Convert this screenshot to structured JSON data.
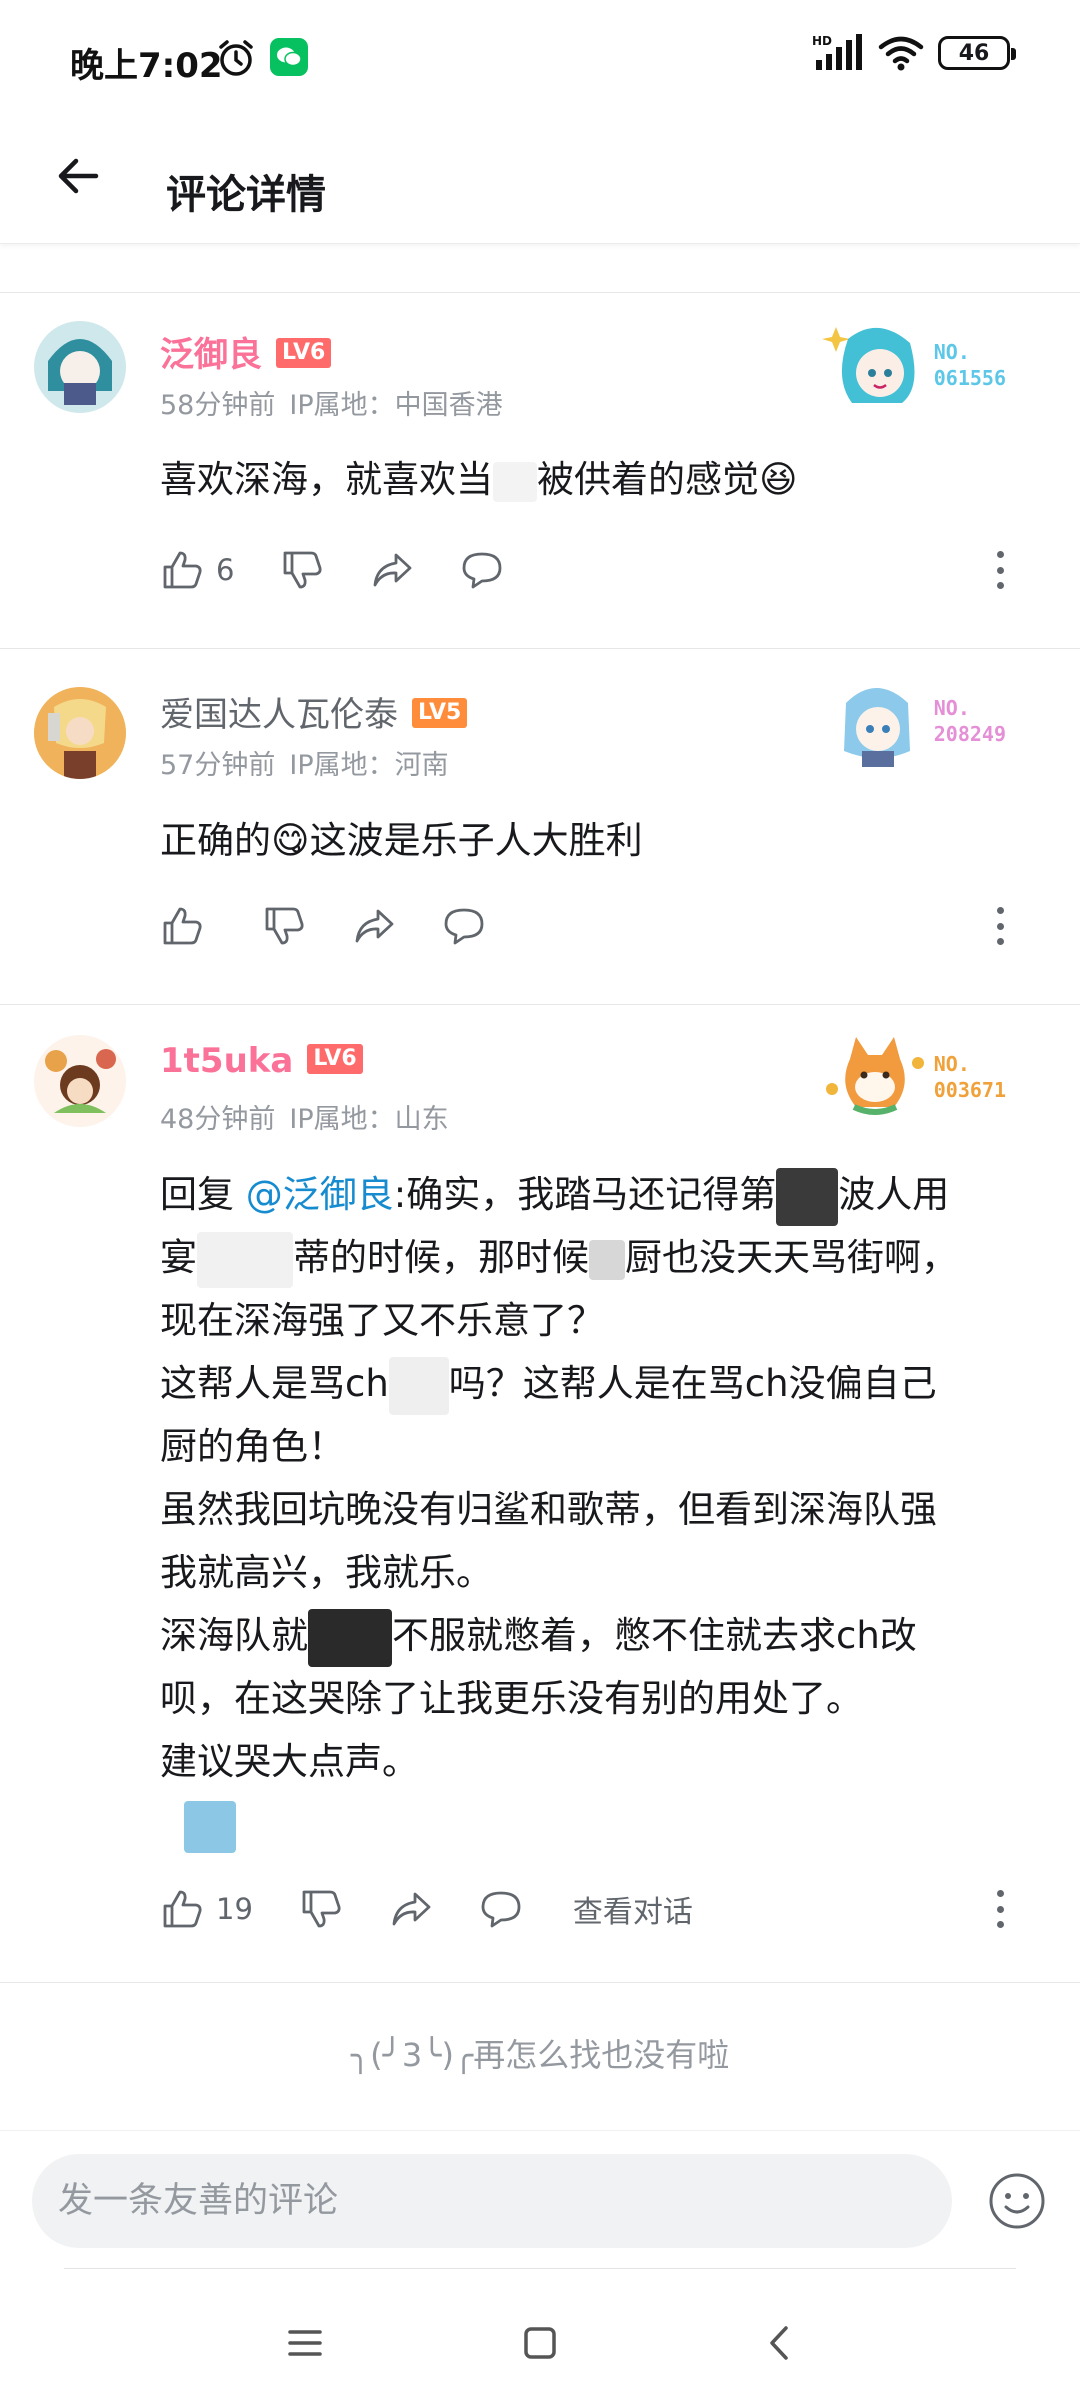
{
  "status_bar": {
    "time": "晚上7:02",
    "network": "HD",
    "battery": "46"
  },
  "header": {
    "title": "评论详情"
  },
  "comments": [
    {
      "username": "泛御良",
      "username_color": "#fb7299",
      "level": "LV6",
      "level_color": "#ff6b6b",
      "time_ago": "58分钟前",
      "ip_location": "IP属地：中国香港",
      "badge_no": "NO.\n061556",
      "badge_color": "#5dc7e8",
      "text_parts": [
        "喜欢深海，就喜欢当",
        "被供着的感觉😆"
      ],
      "like_count": "6"
    },
    {
      "username": "爱国达人瓦伦泰",
      "username_color": "#61666d",
      "level": "LV5",
      "level_color": "#ff8c3a",
      "time_ago": "57分钟前",
      "ip_location": "IP属地：河南",
      "badge_no": "NO.\n208249",
      "badge_color": "#e58fd6",
      "text": "正确的😋这波是乐子人大胜利",
      "like_count": ""
    },
    {
      "username": "1t5uka",
      "username_color": "#fb7299",
      "level": "LV6",
      "level_color": "#ff6b6b",
      "time_ago": "48分钟前",
      "ip_location": "IP属地：山东",
      "badge_no": "NO.\n003671",
      "badge_color": "#f0a13a",
      "reply_prefix": "回复 ",
      "mention": "@泛御良",
      "lines": [
        ":确实，我踏马还记得第",
        "波人用",
        "宴",
        "蒂的时候，那时候",
        "厨也没天天骂街啊，",
        "现在深海强了又不乐意了？",
        "这帮人是骂ch",
        "吗？这帮人是在骂ch没偏自己",
        "厨的角色！",
        "虽然我回坑晚没有归鲨和歌蒂，但看到深海队强",
        "我就高兴，我就乐。",
        "深海队就",
        "不服就憋着，憋不住就去求ch改",
        "呗，在这哭除了让我更乐没有别的用处了。",
        "建议哭大点声。"
      ],
      "like_count": "19",
      "view_conversation": "查看对话"
    }
  ],
  "end_tip": "╮(╯3╰)╭再怎么找也没有啦",
  "input": {
    "placeholder": "发一条友善的评论"
  }
}
